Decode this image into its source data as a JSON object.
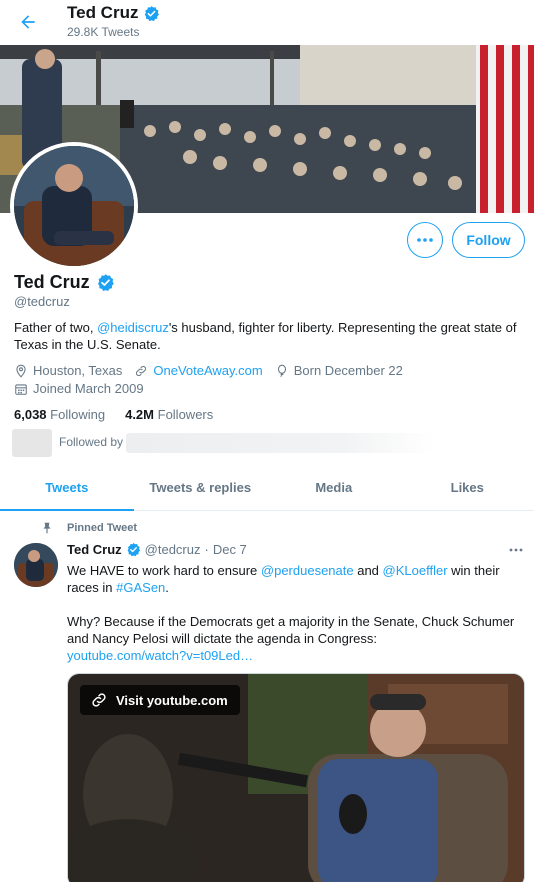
{
  "header": {
    "name": "Ted Cruz",
    "tweet_count": "29.8K Tweets",
    "icons": {
      "back": "arrow-left-icon",
      "verified": "verified-badge-icon"
    }
  },
  "profile": {
    "name": "Ted Cruz",
    "handle": "@tedcruz",
    "bio": {
      "pre": "Father of two, ",
      "mention": "@heidiscruz",
      "post": "'s husband, fighter for liberty. Representing the great state of Texas in the U.S. Senate."
    },
    "location": "Houston, Texas",
    "website": "OneVoteAway.com",
    "birthday": "Born December 22",
    "joined": "Joined March 2009",
    "following_count": "6,038",
    "following_label": "Following",
    "followers_count": "4.2M",
    "followers_label": "Followers",
    "followed_by_label": "Followed by",
    "follow_label": "Follow",
    "more_label": "•••"
  },
  "tabs": [
    {
      "label": "Tweets",
      "active": true
    },
    {
      "label": "Tweets & replies",
      "active": false
    },
    {
      "label": "Media",
      "active": false
    },
    {
      "label": "Likes",
      "active": false
    }
  ],
  "tweet": {
    "pinned_label": "Pinned Tweet",
    "author": "Ted Cruz",
    "handle": "@tedcruz",
    "dot": "·",
    "date": "Dec 7",
    "more_label": "•••",
    "line1_pre": "We HAVE to work hard to ensure ",
    "mention1": "@perduesenate",
    "line1_mid": " and ",
    "mention2": "@KLoeffler",
    "line1_post": " win their races in ",
    "hashtag": "#GASen",
    "line1_end": ".",
    "para2": "Why? Because if the Democrats get a majority in the Senate, Chuck Schumer and Nancy Pelosi will dictate the agenda in Congress:",
    "link": "youtube.com/watch?v=t09Led…",
    "card_visit": "Visit youtube.com"
  },
  "colors": {
    "accent": "#1da1f2",
    "text": "#14171a",
    "secondary": "#657786",
    "border": "#e6ecf0"
  }
}
